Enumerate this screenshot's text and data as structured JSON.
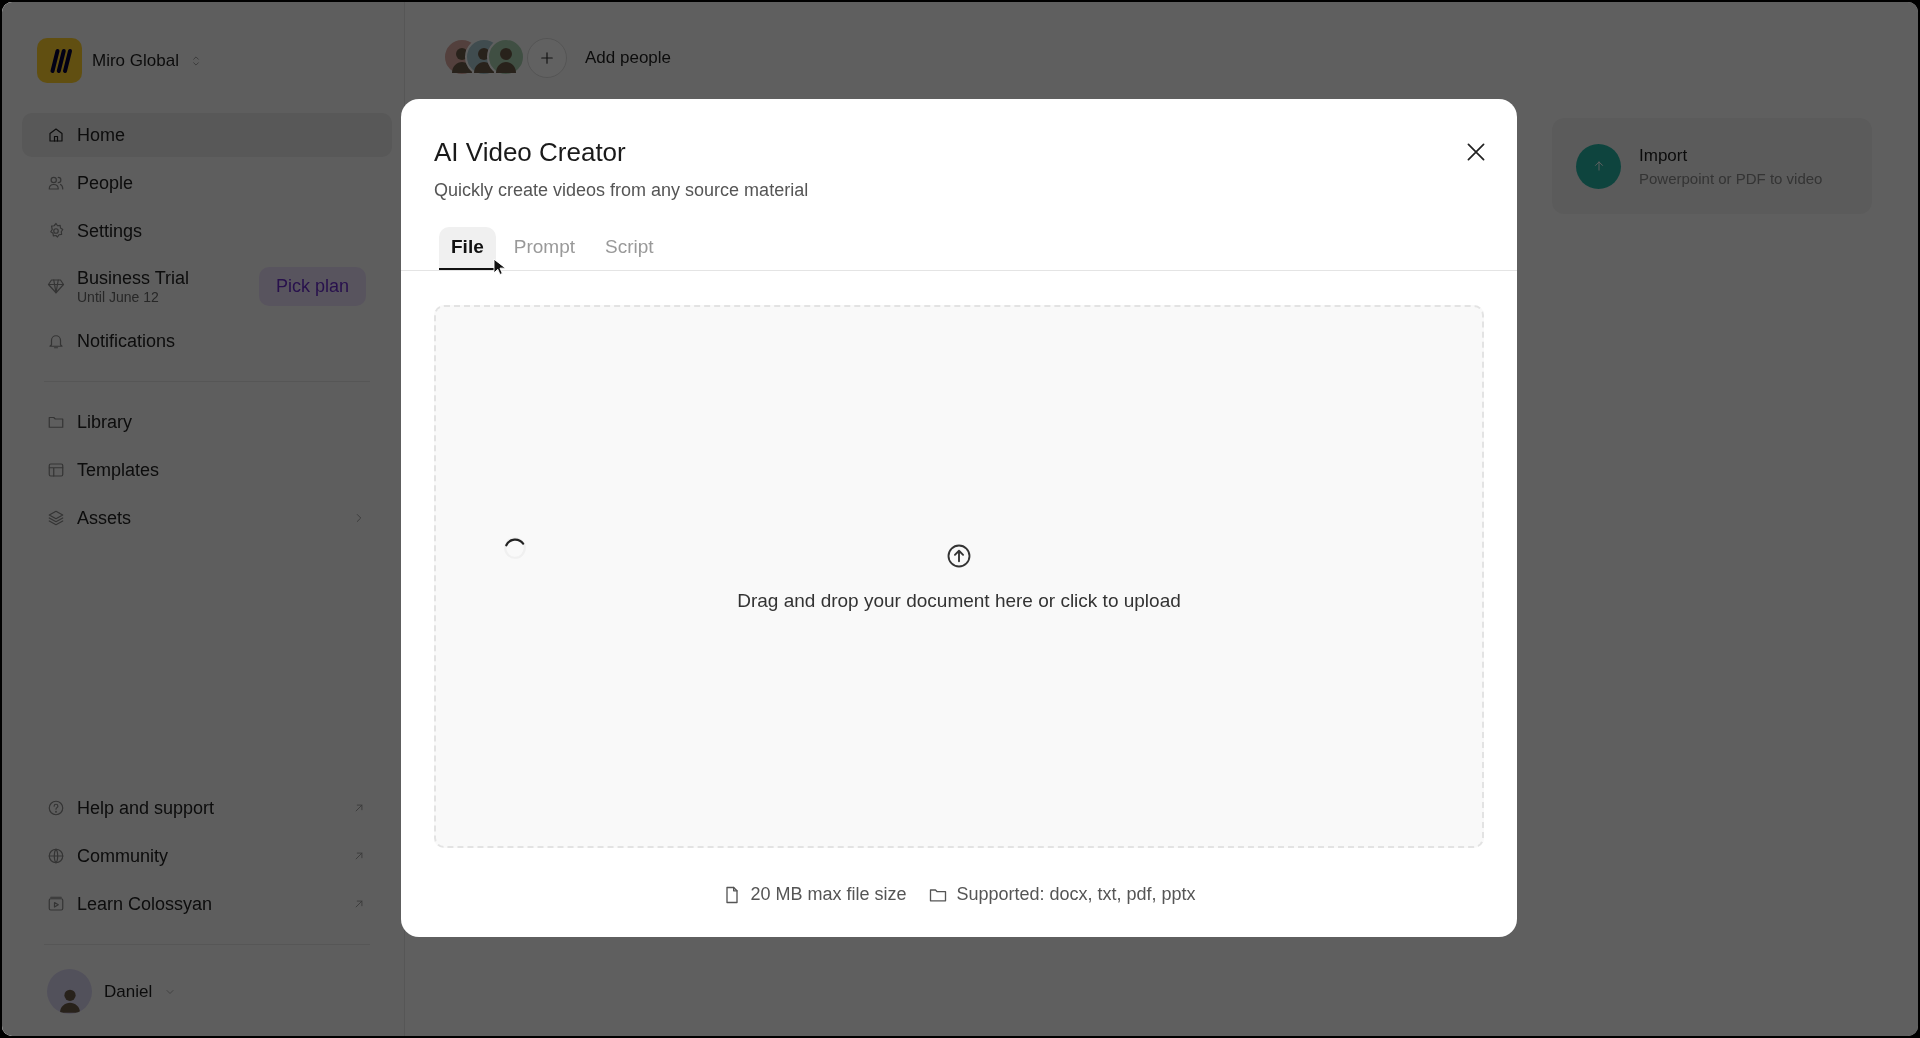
{
  "workspace": {
    "name": "Miro Global"
  },
  "sidebar": {
    "groups": [
      {
        "items": [
          {
            "kind": "nav",
            "label": "Home",
            "selected": true
          },
          {
            "kind": "nav",
            "label": "People",
            "selected": false
          },
          {
            "kind": "nav",
            "label": "Settings",
            "selected": false
          },
          {
            "kind": "trial",
            "label": "Business Trial",
            "sublabel": "Until June 12",
            "button": "Pick plan",
            "selected": false
          },
          {
            "kind": "nav",
            "label": "Notifications",
            "selected": false
          }
        ]
      },
      {
        "items": [
          {
            "kind": "nav",
            "label": "Library",
            "selected": false
          },
          {
            "kind": "nav",
            "label": "Templates",
            "selected": false
          },
          {
            "kind": "submenu",
            "label": "Assets",
            "selected": false
          }
        ]
      }
    ],
    "footer_items": [
      {
        "kind": "external",
        "label": "Help and support"
      },
      {
        "kind": "external",
        "label": "Community"
      },
      {
        "kind": "external",
        "label": "Learn Colossyan"
      }
    ],
    "user": {
      "name": "Daniel"
    }
  },
  "topbar": {
    "add_people": "Add people"
  },
  "import_card": {
    "title": "Import",
    "subtitle": "Powerpoint or PDF to video"
  },
  "modal": {
    "title": "AI Video Creator",
    "subtitle": "Quickly create videos from any source material",
    "tabs": [
      {
        "label": "File",
        "selected": true
      },
      {
        "label": "Prompt",
        "selected": false
      },
      {
        "label": "Script",
        "selected": false
      }
    ],
    "dropzone": {
      "text": "Drag and drop your document here or click to upload",
      "loading": true
    },
    "footer": [
      {
        "kind": "size",
        "text": "20 MB max file size"
      },
      {
        "kind": "formats",
        "text": "Supported: docx, txt, pdf, pptx"
      }
    ]
  }
}
